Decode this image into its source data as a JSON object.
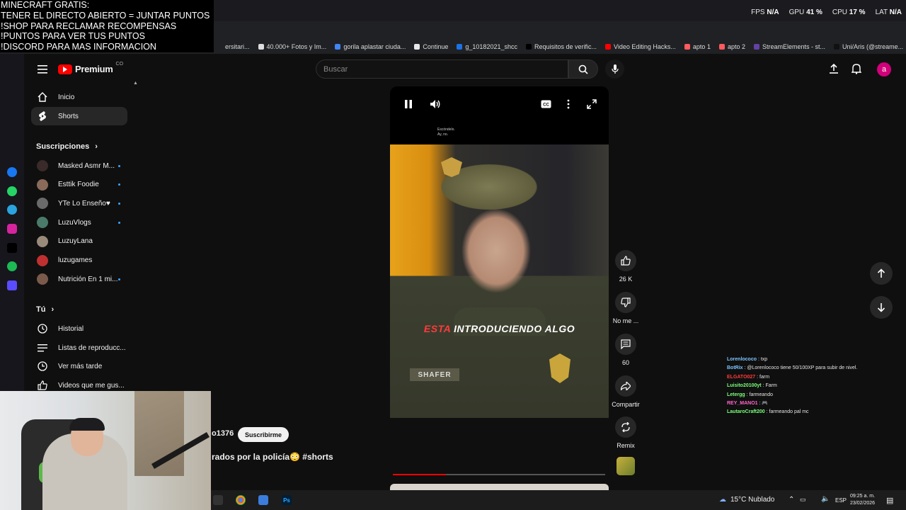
{
  "stream_overlay": {
    "lines": [
      "MINECRAFT GRATIS:",
      "TENER EL DIRECTO ABIERTO = JUNTAR PUNTOS",
      "!SHOP PARA RECLAMAR RECOMPENSAS",
      "!PUNTOS PARA VER TUS PUNTOS",
      "!DISCORD PARA MAS INFORMACION"
    ]
  },
  "perf_stats": {
    "fps_label": "FPS",
    "fps_value": "N/A",
    "gpu_label": "GPU",
    "gpu_value": "41 %",
    "cpu_label": "CPU",
    "cpu_value": "17 %",
    "lat_label": "LAT",
    "lat_value": "N/A"
  },
  "bookmarks": [
    {
      "label": "ersitari...",
      "color": "#202124"
    },
    {
      "label": "40.000+ Fotos y Im...",
      "color": "#dddddd"
    },
    {
      "label": "gorila aplastar ciuda...",
      "color": "#4285f4"
    },
    {
      "label": "Continue",
      "color": "#e8e8e8"
    },
    {
      "label": "g_10182021_shcc",
      "color": "#1a73e8"
    },
    {
      "label": "Requisitos de verific...",
      "color": "#000000"
    },
    {
      "label": "Video Editing Hacks...",
      "color": "#ff0000"
    },
    {
      "label": "apto 1",
      "color": "#ff5a5f"
    },
    {
      "label": "apto 2",
      "color": "#ff5a5f"
    },
    {
      "label": "StreamElements - st...",
      "color": "#6441a5"
    },
    {
      "label": "Uni/Aris (@streame...",
      "color": "#111111"
    }
  ],
  "youtube": {
    "logo_text": "Premium",
    "logo_sup": "CO",
    "search_placeholder": "Buscar",
    "avatar_letter": "a"
  },
  "sidebar": {
    "top": [
      {
        "label": "Inicio",
        "icon": "home-icon"
      },
      {
        "label": "Shorts",
        "icon": "shorts-icon"
      }
    ],
    "subs_header": "Suscripciones",
    "subscriptions": [
      {
        "label": "Masked Asmr M...",
        "avatar_color": "#3a2a2a"
      },
      {
        "label": "Esttik Foodie",
        "avatar_color": "#8a6a5a"
      },
      {
        "label": "YTe Lo Enseño♥",
        "avatar_color": "#6a6a6a"
      },
      {
        "label": "LuzuVlogs",
        "avatar_color": "#4a7a6a"
      },
      {
        "label": "LuzuyLana",
        "avatar_color": "#9a8a7a"
      },
      {
        "label": "luzugames",
        "avatar_color": "#c03030"
      },
      {
        "label": "Nutrición En 1 mi...",
        "avatar_color": "#7a5a4a"
      }
    ],
    "you_header": "Tú",
    "you": [
      {
        "label": "Historial",
        "icon": "history-icon"
      },
      {
        "label": "Listas de reproducc...",
        "icon": "playlist-icon"
      },
      {
        "label": "Ver más tarde",
        "icon": "watch-later-icon"
      },
      {
        "label": "Videos que me gus...",
        "icon": "like-icon"
      }
    ]
  },
  "short": {
    "tiny_caption_1": "Escóndelo.",
    "tiny_caption_2": "Ay, no.",
    "caption_red": "ESTA",
    "caption_white": "INTRODUCIENDO ALGO",
    "nametag": "SHAFER",
    "channel": "o1376",
    "subscribe_label": "Suscribirme",
    "title": "rados por la policía😳 #shorts",
    "progress_fraction": 0.25,
    "actions": {
      "likes": "26 K",
      "dislike_label": "No me ...",
      "comments": "60",
      "share_label": "Compartir",
      "remix_label": "Remix"
    }
  },
  "chat": [
    {
      "user": "Lorenlococo",
      "color": "#7cc6ff",
      "text": "txp"
    },
    {
      "user": "BotRix",
      "color": "#7cc6ff",
      "text": "@Lorenlococo tiene 50/100XP para subir de nivel."
    },
    {
      "user": "ELGATO027",
      "color": "#ff3b3b",
      "text": "farm"
    },
    {
      "user": "Luisito20100yt",
      "color": "#7cff7c",
      "text": "Farm"
    },
    {
      "user": "Letergg",
      "color": "#7cff7c",
      "text": "farmeando"
    },
    {
      "user": "REY_MANO1",
      "color": "#ff66cc",
      "text": "🎮"
    },
    {
      "user": "LautaroCraft200",
      "color": "#7cff7c",
      "text": "farmeando pal mc"
    }
  ],
  "taskbar": {
    "weather": "15°C Nublado",
    "lang": "ESP",
    "time": "09:25 a. m.",
    "date": "23/02/2026"
  }
}
